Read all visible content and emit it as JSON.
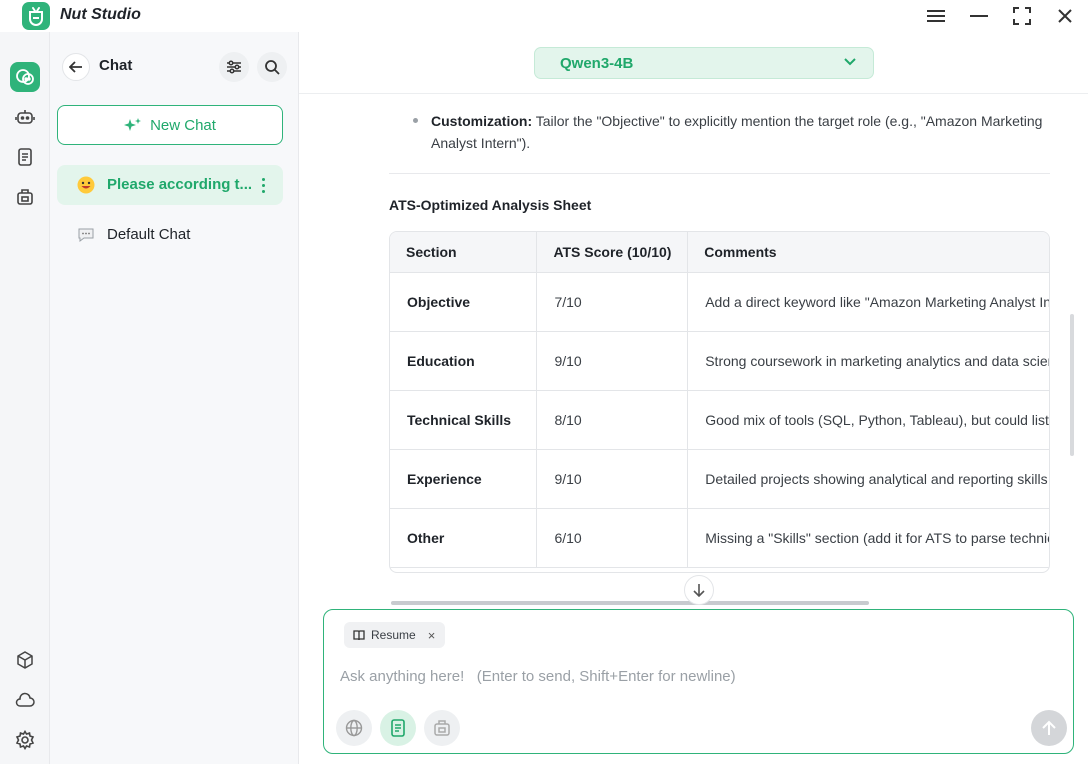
{
  "app": {
    "title": "Nut Studio"
  },
  "sidebar": {
    "title": "Chat",
    "new_chat_label": "New Chat",
    "chats": [
      {
        "label": "Please according t...",
        "active": true
      },
      {
        "label": "Default Chat",
        "active": false
      }
    ]
  },
  "model": {
    "name": "Qwen3-4B"
  },
  "content": {
    "bullet_label": "Customization:",
    "bullet_text": " Tailor the \"Objective\" to explicitly mention the target role (e.g., \"Amazon Marketing Analyst Intern\").",
    "sheet_heading": "ATS-Optimized Analysis Sheet",
    "table": {
      "headers": [
        "Section",
        "ATS Score (10/10)",
        "Comments"
      ],
      "rows": [
        [
          "Objective",
          "7/10",
          "Add a direct keyword like \"Amazon Marketing Analyst In"
        ],
        [
          "Education",
          "9/10",
          "Strong coursework in marketing analytics and data scien"
        ],
        [
          "Technical Skills",
          "8/10",
          "Good mix of tools (SQL, Python, Tableau), but could list"
        ],
        [
          "Experience",
          "9/10",
          "Detailed projects showing analytical and reporting skills"
        ],
        [
          "Other",
          "6/10",
          "Missing a \"Skills\" section (add it for ATS to parse technic"
        ]
      ]
    }
  },
  "composer": {
    "attachment_label": "Resume",
    "attachment_close": "×",
    "placeholder": "Ask anything here!   (Enter to send, Shift+Enter for newline)"
  },
  "colors": {
    "accent": "#2fb37a",
    "accent_light": "#e3f5ec"
  }
}
